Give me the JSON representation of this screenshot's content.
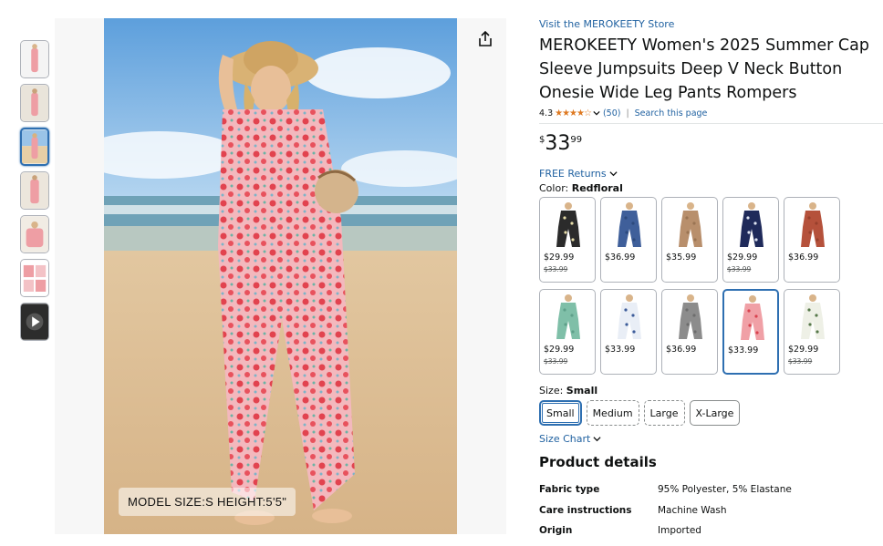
{
  "store": {
    "link_text": "Visit the MEROKEETY Store"
  },
  "product": {
    "title": "MEROKEETY Women's 2025 Summer Cap Sleeve Jumpsuits Deep V Neck Button Onesie Wide Leg Pants Rompers",
    "rating_value": "4.3",
    "stars_glyphs": "★★★★☆",
    "rating_count": "(50)",
    "search_link": "Search this page",
    "separator": "|"
  },
  "price": {
    "symbol": "$",
    "whole": "33",
    "fraction": "99"
  },
  "returns": {
    "label": "FREE Returns"
  },
  "color": {
    "prefix": "Color: ",
    "selected": "Redfloral"
  },
  "swatches": [
    {
      "name": "black-floral",
      "price": "$29.99",
      "old": "$33.99",
      "color": "#2b2b2b",
      "accent": "#e6dca8"
    },
    {
      "name": "blue",
      "price": "$36.99",
      "old": "",
      "color": "#3f5f9a",
      "accent": "#2d4a7d"
    },
    {
      "name": "khaki",
      "price": "$35.99",
      "old": "",
      "color": "#b88f6c",
      "accent": "#9a7453"
    },
    {
      "name": "navy-floral",
      "price": "$29.99",
      "old": "$33.99",
      "color": "#1f2a5a",
      "accent": "#dfe5f3"
    },
    {
      "name": "rust",
      "price": "$36.99",
      "old": "",
      "color": "#b5513b",
      "accent": "#973f2c"
    },
    {
      "name": "mint",
      "price": "$29.99",
      "old": "$33.99",
      "color": "#7fbfa8",
      "accent": "#5ea08a"
    },
    {
      "name": "white-blue-floral",
      "price": "$33.99",
      "old": "",
      "color": "#e9eef6",
      "accent": "#3d5c9a"
    },
    {
      "name": "grey",
      "price": "$36.99",
      "old": "",
      "color": "#8c8c8c",
      "accent": "#6d6d6d"
    },
    {
      "name": "red-floral",
      "price": "$33.99",
      "old": "",
      "color": "#f0a0a6",
      "accent": "#d8434f"
    },
    {
      "name": "white-green-floral",
      "price": "$29.99",
      "old": "$33.99",
      "color": "#eef0e6",
      "accent": "#56784a"
    }
  ],
  "size": {
    "prefix": "Size: ",
    "selected": "Small",
    "options": [
      "Small",
      "Medium",
      "Large",
      "X-Large"
    ],
    "chart_link": "Size Chart"
  },
  "details": {
    "heading": "Product details",
    "rows": [
      {
        "key": "Fabric type",
        "value": "95% Polyester, 5% Elastane"
      },
      {
        "key": "Care instructions",
        "value": "Machine Wash"
      },
      {
        "key": "Origin",
        "value": "Imported"
      }
    ]
  },
  "image": {
    "model_label": "MODEL SIZE:S  HEIGHT:5'5\""
  },
  "colors": {
    "link": "#2162a1",
    "star": "#de7921",
    "selected_border": "#2e6fb1"
  }
}
